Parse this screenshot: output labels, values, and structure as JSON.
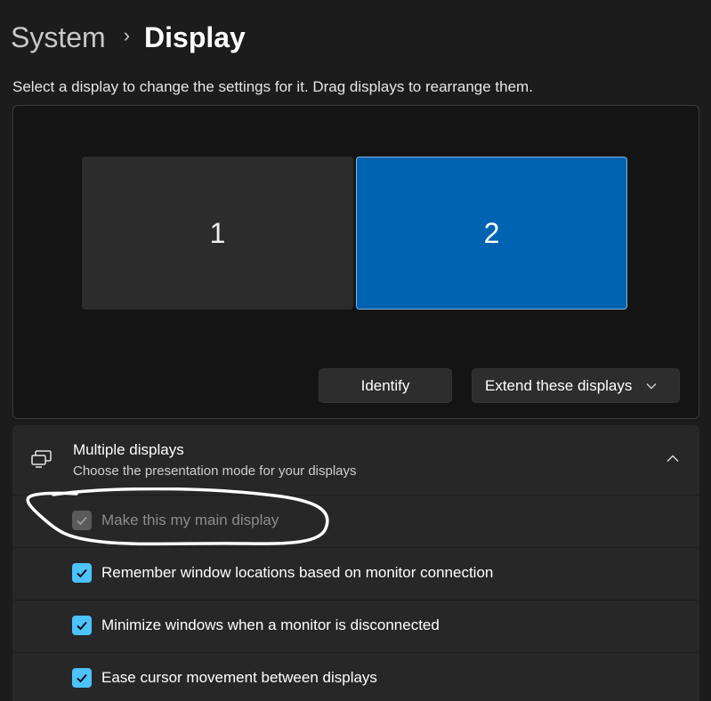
{
  "breadcrumb": {
    "parent": "System",
    "separator": "›",
    "current": "Display"
  },
  "instruction": "Select a display to change the settings for it. Drag displays to rearrange them.",
  "arrangement": {
    "monitors": [
      {
        "label": "1",
        "selected": false
      },
      {
        "label": "2",
        "selected": true
      }
    ],
    "identify_label": "Identify",
    "mode_select": {
      "value": "Extend these displays",
      "icon": "chevron-down-icon"
    }
  },
  "multiple_displays": {
    "icon": "multiple-displays-icon",
    "title": "Multiple displays",
    "subtitle": "Choose the presentation mode for your displays",
    "expanded": true,
    "options": [
      {
        "label": "Make this my main display",
        "checked": true,
        "disabled": true
      },
      {
        "label": "Remember window locations based on monitor connection",
        "checked": true,
        "disabled": false
      },
      {
        "label": "Minimize windows when a monitor is disconnected",
        "checked": true,
        "disabled": false
      },
      {
        "label": "Ease cursor movement between displays",
        "checked": true,
        "disabled": false
      }
    ]
  },
  "colors": {
    "accent": "#4cc2ff",
    "selected_monitor": "#0063b1",
    "background": "#1c1c1c",
    "annotation_ink": "#ffffff"
  }
}
